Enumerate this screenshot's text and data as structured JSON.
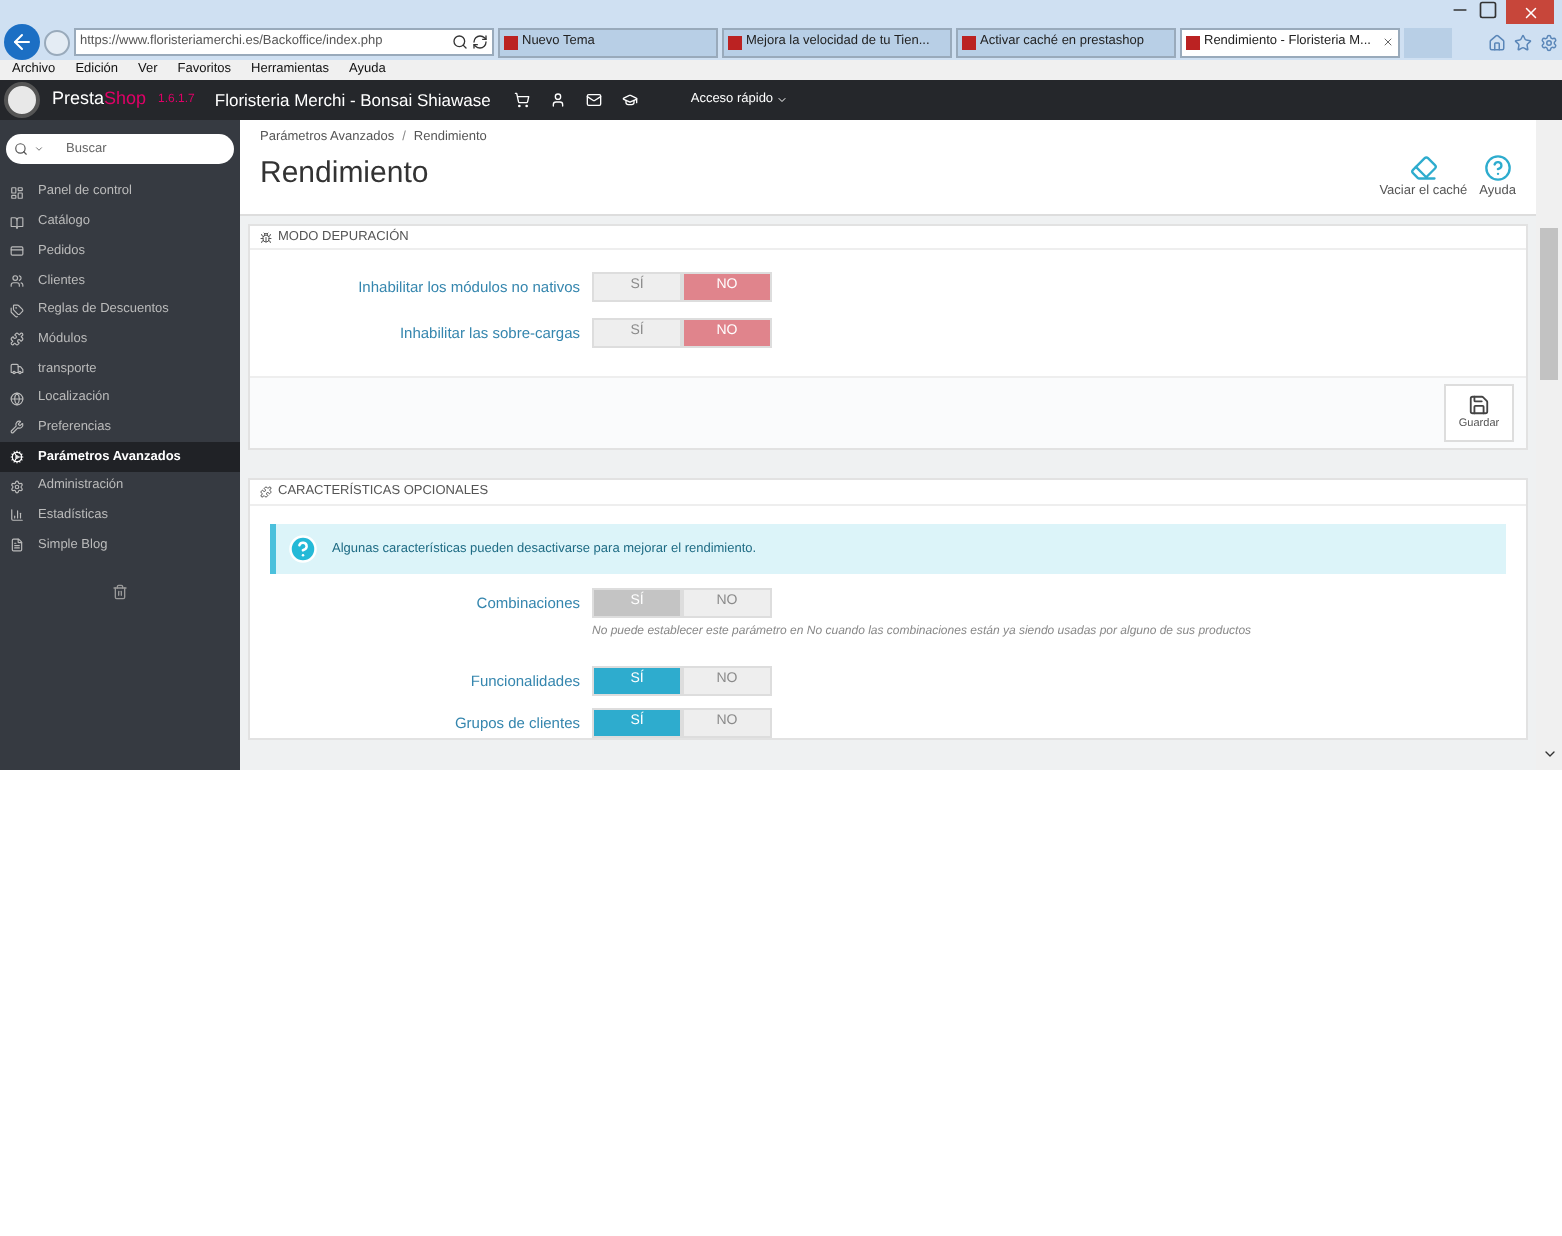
{
  "browser": {
    "address": "https://www.floristeriamerchi.es/Backoffice/index.php",
    "tabs": [
      {
        "label": "Nuevo Tema",
        "selected": false
      },
      {
        "label": "Mejora la velocidad de tu Tien...",
        "selected": false
      },
      {
        "label": "Activar caché en prestashop",
        "selected": false
      },
      {
        "label": "Rendimiento - Floristeria M...",
        "selected": true
      }
    ],
    "menu": [
      "Archivo",
      "Edición",
      "Ver",
      "Favoritos",
      "Herramientas",
      "Ayuda"
    ]
  },
  "header": {
    "brand": [
      "Presta",
      "Shop"
    ],
    "version": "1.6.1.7",
    "shop_name": "Floristeria Merchi - Bonsai Shiawase",
    "quick_access": "Acceso rápido"
  },
  "sidebar": {
    "search": {
      "placeholder": "Buscar"
    },
    "items": [
      {
        "label": "Panel de control",
        "selected": false
      },
      {
        "label": "Catálogo",
        "selected": false
      },
      {
        "label": "Pedidos",
        "selected": false
      },
      {
        "label": "Clientes",
        "selected": false
      },
      {
        "label": "Reglas de Descuentos",
        "selected": false
      },
      {
        "label": "Módulos",
        "selected": false
      },
      {
        "label": "transporte",
        "selected": false
      },
      {
        "label": "Localización",
        "selected": false
      },
      {
        "label": "Preferencias",
        "selected": false
      },
      {
        "label": "Parámetros Avanzados",
        "selected": true
      },
      {
        "label": "Administración",
        "selected": false
      },
      {
        "label": "Estadísticas",
        "selected": false
      },
      {
        "label": "Simple Blog",
        "selected": false
      }
    ]
  },
  "breadcrumb": [
    "Parámetros Avanzados",
    "Rendimiento"
  ],
  "breadcrumb_separator": "/",
  "title": "Rendimiento",
  "toolbar": [
    "Vaciar el caché",
    "Ayuda"
  ],
  "panels": [
    {
      "title": "MODO DEPURACIÓN",
      "save": "Guardar",
      "fields": [
        {
          "label": "Inhabilitar los módulos no nativos",
          "disabled": false,
          "options": [
            {
              "label": "SÍ",
              "selected": false
            },
            {
              "label": "NO",
              "selected": true
            }
          ]
        },
        {
          "label": "Inhabilitar las sobre-cargas",
          "disabled": false,
          "options": [
            {
              "label": "SÍ",
              "selected": false
            },
            {
              "label": "NO",
              "selected": true
            }
          ]
        }
      ]
    },
    {
      "title": "CARACTERÍSTICAS OPCIONALES",
      "alert": "Algunas características pueden desactivarse para mejorar el rendimiento.",
      "fields": [
        {
          "label": "Combinaciones",
          "disabled": true,
          "help": "No puede establecer este parámetro en No cuando las combinaciones están ya siendo usadas por alguno de sus productos",
          "options": [
            {
              "label": "SÍ",
              "selected": true
            },
            {
              "label": "NO",
              "selected": false
            }
          ]
        },
        {
          "label": "Funcionalidades",
          "disabled": false,
          "options": [
            {
              "label": "SÍ",
              "selected": true
            },
            {
              "label": "NO",
              "selected": false
            }
          ]
        },
        {
          "label": "Grupos de clientes",
          "disabled": false,
          "options": [
            {
              "label": "SÍ",
              "selected": true
            },
            {
              "label": "NO",
              "selected": false
            }
          ]
        }
      ]
    }
  ]
}
